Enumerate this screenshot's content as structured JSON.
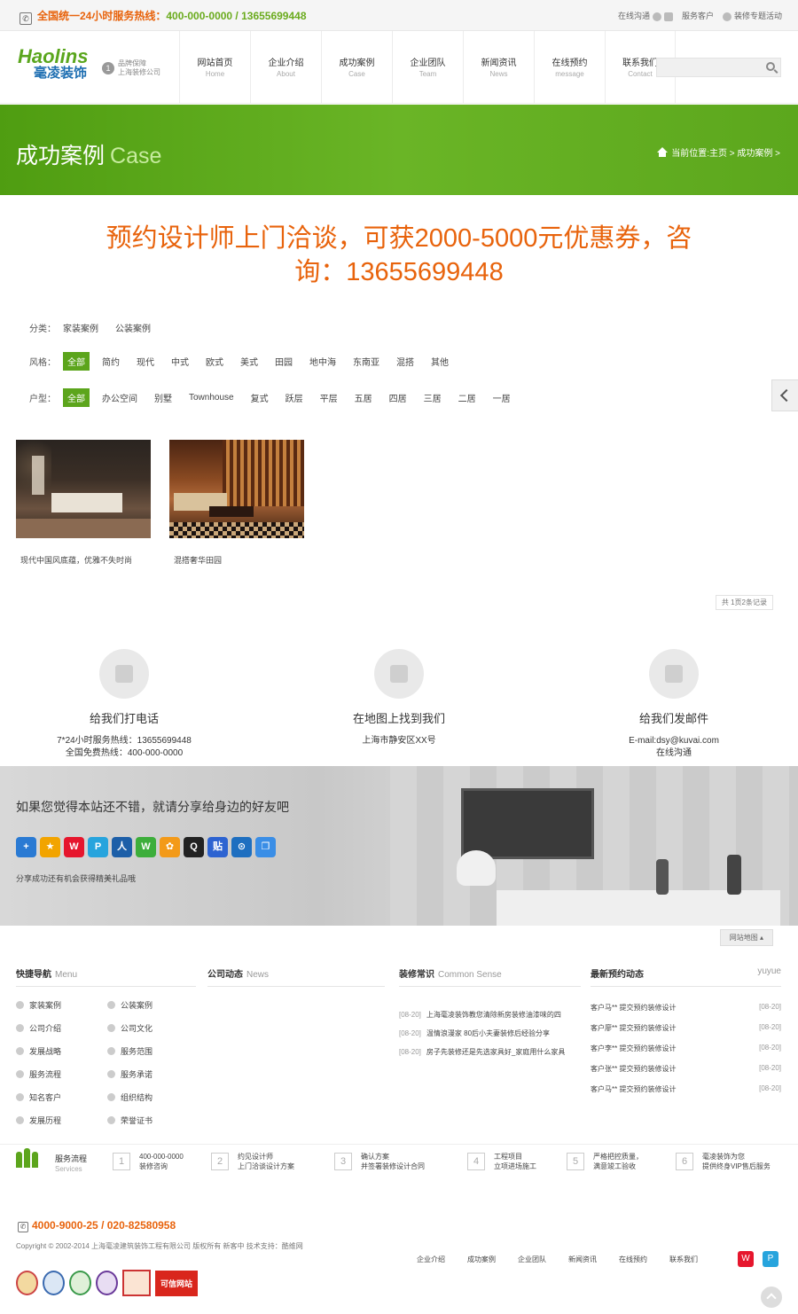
{
  "topbar": {
    "hotline_label": "全国统一24小时服务热线：",
    "hotline_number": "400-000-0000 / 13655699448",
    "links": [
      "在线沟通",
      "服务客户",
      "装修专题活动"
    ]
  },
  "header": {
    "logo_en": "Haolins",
    "logo_cn": "毫凌装饰",
    "badge_num": "1",
    "badge_line1": "品牌保障",
    "badge_line2": "上海装修公司",
    "search_placeholder": ""
  },
  "nav": [
    {
      "cn": "网站首页",
      "en": "Home"
    },
    {
      "cn": "企业介绍",
      "en": "About"
    },
    {
      "cn": "成功案例",
      "en": "Case"
    },
    {
      "cn": "企业团队",
      "en": "Team"
    },
    {
      "cn": "新闻资讯",
      "en": "News"
    },
    {
      "cn": "在线预约",
      "en": "message"
    },
    {
      "cn": "联系我们",
      "en": "Contact"
    }
  ],
  "banner": {
    "title": "成功案例",
    "title_en": "Case",
    "breadcrumb": "当前位置:主页 > 成功案例 >"
  },
  "promo": {
    "line1": "预约设计师上门洽谈，可获2000-5000元优惠券，咨",
    "line2": "询：13655699448"
  },
  "filters": {
    "category": {
      "label": "分类：",
      "options": [
        "家装案例",
        "公装案例"
      ]
    },
    "style": {
      "label": "风格：",
      "options": [
        "全部",
        "简约",
        "现代",
        "中式",
        "欧式",
        "美式",
        "田园",
        "地中海",
        "东南亚",
        "混搭",
        "其他"
      ]
    },
    "type": {
      "label": "户型：",
      "options": [
        "全部",
        "办公空间",
        "别墅",
        "Townhouse",
        "复式",
        "跃层",
        "平层",
        "五居",
        "四居",
        "三居",
        "二居",
        "一居"
      ]
    }
  },
  "cases": [
    {
      "caption": "现代中国风底蕴，优雅不失时尚"
    },
    {
      "caption": "混搭奢华田园"
    }
  ],
  "pager": "共 1页2条记录",
  "contacts": [
    {
      "title": "给我们打电话",
      "line1": "7*24小时服务热线：13655699448",
      "line2": "全国免费热线：400-000-0000",
      "icon": "phone-icon"
    },
    {
      "title": "在地图上找到我们",
      "line1": "上海市静安区XX号",
      "line2": "",
      "icon": "map-icon"
    },
    {
      "title": "给我们发邮件",
      "line1": "E-mail:dsy@kuvai.com",
      "line2": "在线沟通",
      "icon": "mail-icon"
    }
  ],
  "share": {
    "text": "如果您觉得本站还不错，就请分享给身边的好友吧",
    "note": "分享成功还有机会获得精美礼品哦",
    "icons": [
      {
        "name": "more-share-icon",
        "glyph": "+",
        "color": "#2a7ad3"
      },
      {
        "name": "qzone-icon",
        "glyph": "★",
        "color": "#f2a400"
      },
      {
        "name": "weibo-icon",
        "glyph": "W",
        "color": "#e6162d"
      },
      {
        "name": "tencent-weibo-icon",
        "glyph": "P",
        "color": "#27a4dd"
      },
      {
        "name": "renren-icon",
        "glyph": "人",
        "color": "#1d5fa8"
      },
      {
        "name": "wechat-icon",
        "glyph": "W",
        "color": "#3dae3b"
      },
      {
        "name": "pengyou-icon",
        "glyph": "✿",
        "color": "#f39a19"
      },
      {
        "name": "qq-icon",
        "glyph": "Q",
        "color": "#222"
      },
      {
        "name": "baidu-icon",
        "glyph": "贴",
        "color": "#2d63d1"
      },
      {
        "name": "kaixin-icon",
        "glyph": "⊙",
        "color": "#1e6fc0"
      },
      {
        "name": "copy-icon",
        "glyph": "❐",
        "color": "#3a8ee6"
      }
    ]
  },
  "sitemap": "网站地图 ▴",
  "footer": {
    "menu": {
      "title": "快捷导航",
      "en": "Menu",
      "items": [
        "家装案例",
        "公装案例",
        "公司介绍",
        "公司文化",
        "发展战略",
        "服务范围",
        "服务流程",
        "服务承诺",
        "知名客户",
        "组织结构",
        "发展历程",
        "荣誉证书"
      ]
    },
    "news": {
      "title": "公司动态",
      "en": "News"
    },
    "sense": {
      "title": "装修常识",
      "en": "Common Sense",
      "items": [
        {
          "date": "[08-20]",
          "text": "上海毫凌装饰教您清除新房装修油漆味的四"
        },
        {
          "date": "[08-20]",
          "text": "温情浪漫家 80后小夫妻装修后经验分享"
        },
        {
          "date": "[08-20]",
          "text": "房子先装修还是先选家具好_家庭用什么家具"
        }
      ]
    },
    "yuyue": {
      "title": "最新预约动态",
      "en": "yuyue",
      "items": [
        {
          "text": "客户马** 提交预约装修设计",
          "date": "[08-20]"
        },
        {
          "text": "客户廖** 提交预约装修设计",
          "date": "[08-20]"
        },
        {
          "text": "客户李** 提交预约装修设计",
          "date": "[08-20]"
        },
        {
          "text": "客户张** 提交预约装修设计",
          "date": "[08-20]"
        },
        {
          "text": "客户马** 提交预约装修设计",
          "date": "[08-20]"
        }
      ]
    }
  },
  "steps": {
    "label": "服务流程",
    "label_en": "Services",
    "items": [
      {
        "n": "1",
        "l1": "400-000-0000",
        "l2": "装修咨询"
      },
      {
        "n": "2",
        "l1": "约见设计师",
        "l2": "上门洽谈设计方案"
      },
      {
        "n": "3",
        "l1": "确认方案",
        "l2": "并签署装修设计合同"
      },
      {
        "n": "4",
        "l1": "工程项目",
        "l2": "立项进场施工"
      },
      {
        "n": "5",
        "l1": "严格把控质量，",
        "l2": "满意竣工验收"
      },
      {
        "n": "6",
        "l1": "毫凌装饰为您",
        "l2": "提供终身VIP售后服务"
      }
    ]
  },
  "bottom": {
    "phone": "4000-9000-25 / 020-82580958",
    "copyright": "Copyright © 2002-2014 上海毫凌建筑装饰工程有限公司 版权所有 新客中 技术支持：酷维网",
    "links": [
      "企业介绍",
      "成功案例",
      "企业团队",
      "新闻资讯",
      "在线预约",
      "联系我们"
    ],
    "credit_badge": "可信网站"
  }
}
